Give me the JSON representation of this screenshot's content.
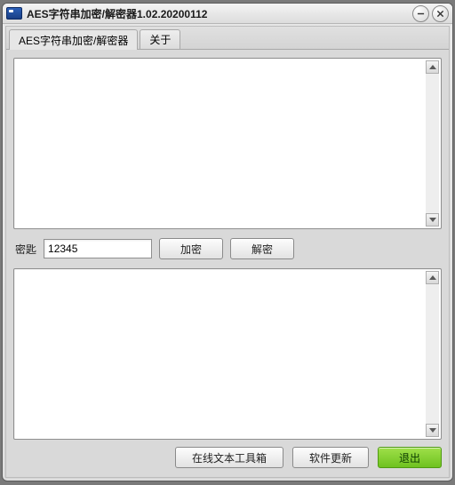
{
  "window": {
    "title": "AES字符串加密/解密器1.02.20200112"
  },
  "tabs": {
    "main": "AES字符串加密/解密器",
    "about": "关于"
  },
  "input_text": "",
  "output_text": "",
  "key": {
    "label": "密匙",
    "value": "12345"
  },
  "actions": {
    "encrypt": "加密",
    "decrypt": "解密"
  },
  "footer": {
    "toolbox": "在线文本工具箱",
    "update": "软件更新",
    "exit": "退出"
  }
}
